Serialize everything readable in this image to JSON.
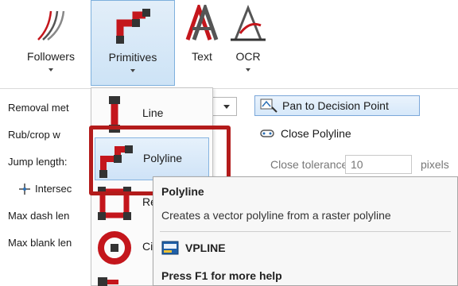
{
  "ribbon": {
    "buttons": [
      {
        "label": "Followers",
        "icon": "followers-icon",
        "active": false
      },
      {
        "label": "Primitives",
        "icon": "primitives-icon",
        "active": true
      },
      {
        "label": "Text",
        "icon": "text-icon",
        "active": false
      },
      {
        "label": "OCR",
        "icon": "ocr-icon",
        "active": false
      }
    ]
  },
  "left_panel": {
    "rows": [
      "Removal met",
      "Rub/crop w",
      "Jump length:",
      "Intersec",
      "Max dash len",
      "Max blank len"
    ]
  },
  "menu": {
    "items": [
      {
        "label": "Line",
        "icon": "line-icon"
      },
      {
        "label": "Polyline",
        "icon": "polyline-icon",
        "selected": true
      },
      {
        "label": "Re",
        "icon": "rectangle-icon"
      },
      {
        "label": "Cir",
        "icon": "circle-icon"
      }
    ]
  },
  "right_panel": {
    "pan_button": "Pan to Decision Point",
    "close_polyline": "Close Polyline",
    "tolerance_label": "Close tolerance:",
    "tolerance_value": "10",
    "tolerance_unit": "pixels"
  },
  "tooltip": {
    "title": "Polyline",
    "description": "Creates a vector polyline from a raster polyline",
    "command": "VPLINE",
    "help": "Press F1 for more help"
  },
  "colors": {
    "highlight_border": "#b31b1b",
    "selection_fill": "#cfe3f7",
    "icon_red": "#c4161c"
  }
}
